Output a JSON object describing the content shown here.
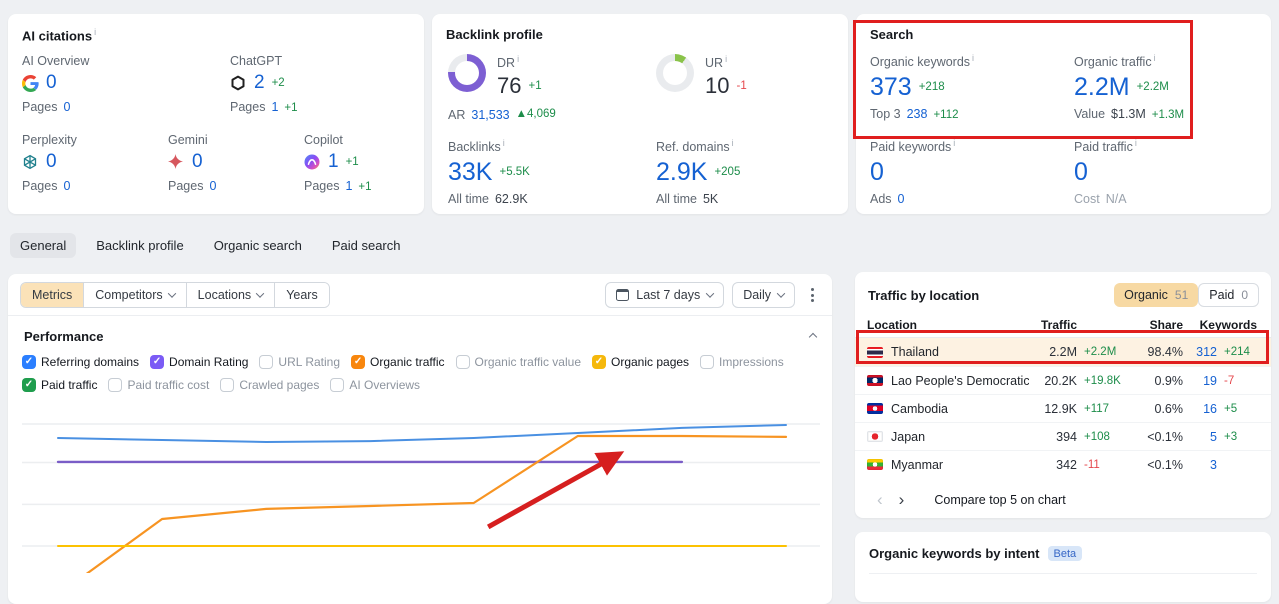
{
  "icons": {
    "info": "i",
    "check": "✓"
  },
  "cards": {
    "ai_citations": {
      "title": "AI citations",
      "pages_label": "Pages",
      "items": [
        {
          "name": "AI Overview",
          "icon": "google",
          "value": "0",
          "delta": "",
          "pages": "0",
          "pages_delta": ""
        },
        {
          "name": "ChatGPT",
          "icon": "chatgpt",
          "value": "2",
          "delta": "+2",
          "pages": "1",
          "pages_delta": "+1"
        },
        {
          "name": "Perplexity",
          "icon": "perplexity",
          "value": "0",
          "delta": "",
          "pages": "0",
          "pages_delta": ""
        },
        {
          "name": "Gemini",
          "icon": "gemini",
          "value": "0",
          "delta": "",
          "pages": "0",
          "pages_delta": ""
        },
        {
          "name": "Copilot",
          "icon": "copilot",
          "value": "1",
          "delta": "+1",
          "pages": "1",
          "pages_delta": "+1"
        }
      ]
    },
    "backlink_profile": {
      "title": "Backlink profile",
      "alltime_label": "All time",
      "dr": {
        "label": "DR",
        "value": "76",
        "delta": "+1",
        "percent": 76,
        "color": "#7d5fd3"
      },
      "ar": {
        "label": "AR",
        "value": "31,533",
        "delta": "▲4,069"
      },
      "ur": {
        "label": "UR",
        "value": "10",
        "delta": "-1",
        "percent": 10,
        "color": "#8ac34a"
      },
      "backlinks": {
        "label": "Backlinks",
        "value": "33K",
        "delta": "+5.5K",
        "alltime": "62.9K"
      },
      "ref_domains": {
        "label": "Ref. domains",
        "value": "2.9K",
        "delta": "+205",
        "alltime": "5K"
      }
    },
    "search": {
      "title": "Search",
      "organic_keywords": {
        "label": "Organic keywords",
        "value": "373",
        "delta": "+218",
        "sub_label": "Top 3",
        "sub_value": "238",
        "sub_delta": "+112"
      },
      "organic_traffic": {
        "label": "Organic traffic",
        "value": "2.2M",
        "delta": "+2.2M",
        "sub_label": "Value",
        "sub_value": "$1.3M",
        "sub_delta": "+1.3M"
      },
      "paid_keywords": {
        "label": "Paid keywords",
        "value": "0",
        "delta": "",
        "sub_label": "Ads",
        "sub_value": "0",
        "sub_delta": ""
      },
      "paid_traffic": {
        "label": "Paid traffic",
        "value": "0",
        "delta": "",
        "sub_label": "Cost",
        "sub_value": "N/A",
        "sub_delta": ""
      }
    }
  },
  "tabs": {
    "items": [
      "General",
      "Backlink profile",
      "Organic search",
      "Paid search"
    ],
    "active_index": 0
  },
  "filters": {
    "metrics": "Metrics",
    "competitors": "Competitors",
    "locations": "Locations",
    "years": "Years",
    "date_range": "Last 7 days",
    "granularity": "Daily"
  },
  "performance": {
    "title": "Performance",
    "checkboxes": [
      {
        "label": "Referring domains",
        "checked": true,
        "color": "#2b7fff"
      },
      {
        "label": "Domain Rating",
        "checked": true,
        "color": "#7b5bf5"
      },
      {
        "label": "URL Rating",
        "checked": false
      },
      {
        "label": "Organic traffic",
        "checked": true,
        "color": "#f8860d"
      },
      {
        "label": "Organic traffic value",
        "checked": false
      },
      {
        "label": "Organic pages",
        "checked": true,
        "color": "#f5b80c"
      },
      {
        "label": "Impressions",
        "checked": false
      },
      {
        "label": "Paid traffic",
        "checked": true,
        "color": "#1f9d4d"
      },
      {
        "label": "Paid traffic cost",
        "checked": false
      },
      {
        "label": "Crawled pages",
        "checked": false
      },
      {
        "label": "AI Overviews",
        "checked": false
      }
    ]
  },
  "chart_data": {
    "type": "line",
    "title": "Performance",
    "x": {
      "range_label": "Last 7 days",
      "granularity": "Daily",
      "num_points": 8,
      "tick_labels_visible": false
    },
    "y": {
      "tick_labels_visible": false,
      "gridlines_frac": [
        0.828,
        0.614,
        0.381,
        0.15
      ]
    },
    "series": [
      {
        "name": "Referring domains",
        "color": "#4a90e2",
        "width": 2,
        "fx": [
          0,
          0.143,
          0.286,
          0.429,
          0.571,
          0.714,
          0.857,
          1
        ],
        "fy": [
          0.75,
          0.739,
          0.728,
          0.733,
          0.75,
          0.778,
          0.806,
          0.822
        ]
      },
      {
        "name": "Domain Rating",
        "color": "#7a5dc7",
        "width": 2.4,
        "fx": [
          0,
          0.143,
          0.286,
          0.429,
          0.571,
          0.714,
          0.857
        ],
        "fy": [
          0.617,
          0.617,
          0.617,
          0.617,
          0.617,
          0.617,
          0.617
        ]
      },
      {
        "name": "Organic traffic",
        "color": "#f79422",
        "width": 2.2,
        "fx": [
          0,
          0.143,
          0.286,
          0.429,
          0.571,
          0.714,
          0.857,
          1
        ],
        "fy": [
          -0.12,
          0.3,
          0.356,
          0.372,
          0.389,
          0.761,
          0.761,
          0.756
        ]
      },
      {
        "name": "Organic pages",
        "color": "#fcc201",
        "width": 2,
        "fx": [
          0,
          1
        ],
        "fy": [
          0.15,
          0.15
        ]
      }
    ],
    "annotation_arrow": {
      "color": "#d61f1f",
      "from_fx": 0.591,
      "from_fy": 0.256,
      "to_fx": 0.761,
      "to_fy": 0.639
    }
  },
  "traffic_by_location": {
    "title": "Traffic by location",
    "toggle": [
      {
        "label": "Organic",
        "count": "51",
        "active": true
      },
      {
        "label": "Paid",
        "count": "0",
        "active": false
      }
    ],
    "columns": [
      "Location",
      "Traffic",
      "Share",
      "Keywords"
    ],
    "rows": [
      {
        "location": "Thailand",
        "flag": "thailand",
        "traffic": "2.2M",
        "traffic_delta": "+2.2M",
        "share": "98.4%",
        "keywords": "312",
        "keywords_delta": "+214",
        "highlighted": true
      },
      {
        "location": "Lao People's Democratic Reput",
        "flag": "laos",
        "traffic": "20.2K",
        "traffic_delta": "+19.8K",
        "share": "0.9%",
        "keywords": "19",
        "keywords_delta": "-7"
      },
      {
        "location": "Cambodia",
        "flag": "cambodia",
        "traffic": "12.9K",
        "traffic_delta": "+117",
        "share": "0.6%",
        "keywords": "16",
        "keywords_delta": "+5"
      },
      {
        "location": "Japan",
        "flag": "japan",
        "traffic": "394",
        "traffic_delta": "+108",
        "share": "<0.1%",
        "keywords": "5",
        "keywords_delta": "+3"
      },
      {
        "location": "Myanmar",
        "flag": "myanmar",
        "traffic": "342",
        "traffic_delta": "-11",
        "share": "<0.1%",
        "keywords": "3",
        "keywords_delta": ""
      }
    ],
    "footer": "Compare top 5 on chart"
  },
  "intent": {
    "title": "Organic keywords by intent",
    "badge": "Beta"
  }
}
